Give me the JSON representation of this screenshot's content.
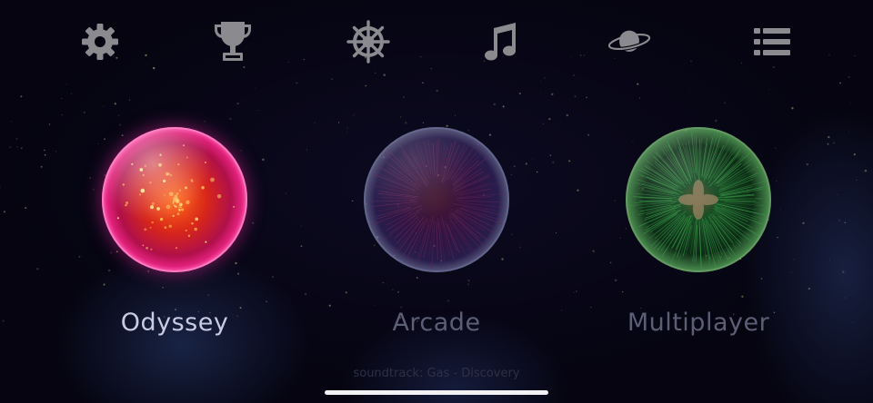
{
  "toolbar": {
    "icons": [
      "gear-icon",
      "trophy-icon",
      "ship-wheel-icon",
      "music-note-icon",
      "planet-icon",
      "list-icon"
    ],
    "icon_color": "#8a8a8f"
  },
  "modes": [
    {
      "label": "Odyssey",
      "state": "selected",
      "orb_color": "#e0207a"
    },
    {
      "label": "Arcade",
      "state": "locked",
      "orb_color": "#5a3a8a"
    },
    {
      "label": "Multiplayer",
      "state": "locked",
      "orb_color": "#2e9a3a"
    }
  ],
  "footer": {
    "soundtrack": "soundtrack: Gas - Discovery"
  },
  "colors": {
    "background": "#050410",
    "label_selected": "#c9cbe2",
    "label_dimmed": "#5c5e76"
  }
}
